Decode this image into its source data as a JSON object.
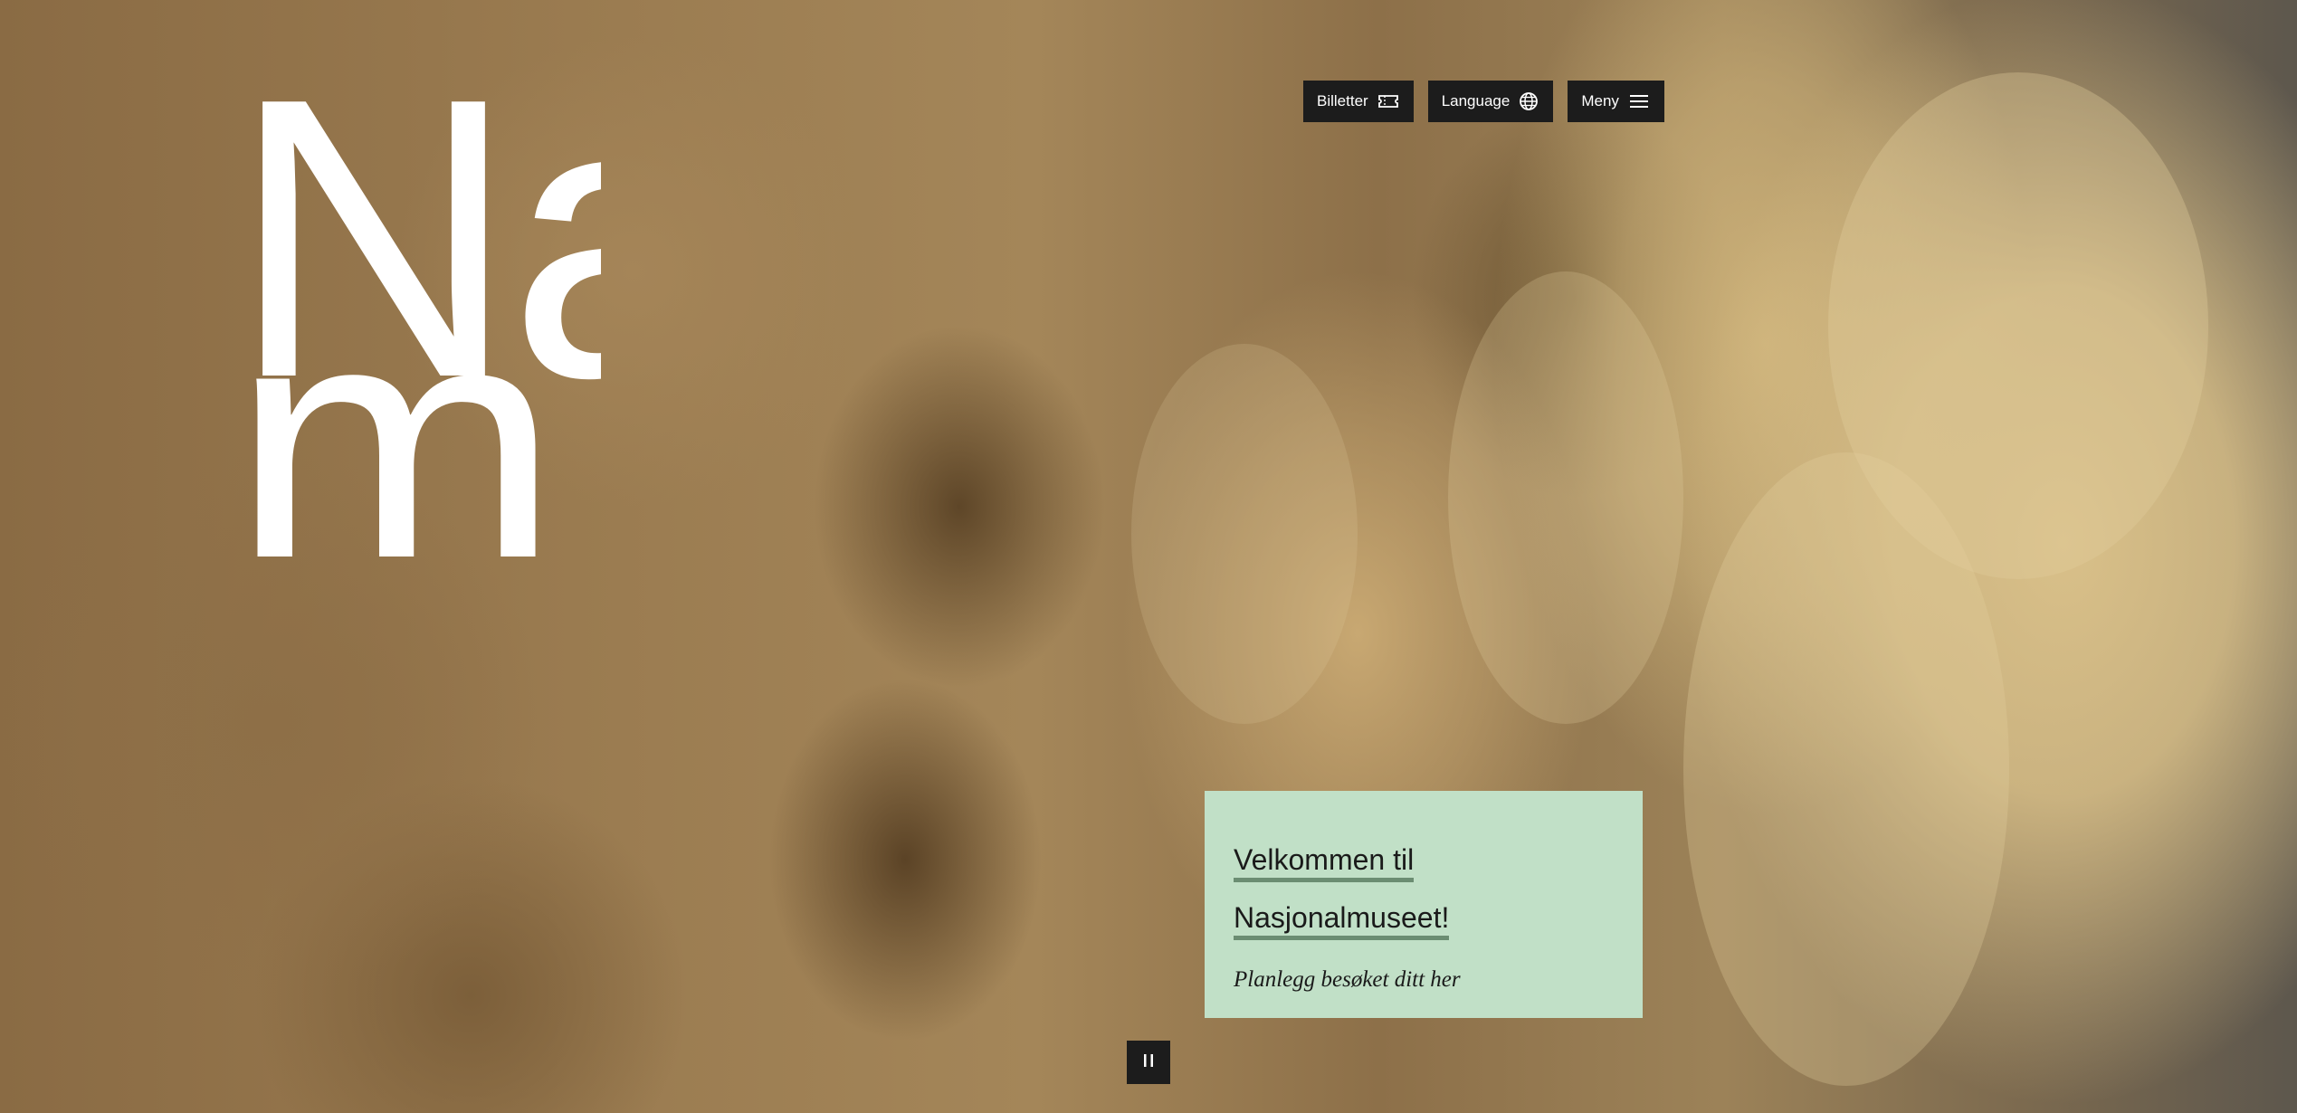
{
  "logo": {
    "line1": "Na",
    "line2": "m"
  },
  "nav": {
    "tickets_label": "Billetter",
    "tickets_icon": "ticket-icon",
    "language_label": "Language",
    "language_icon": "globe-icon",
    "menu_label": "Meny",
    "menu_icon": "hamburger-icon"
  },
  "welcome": {
    "title_line1": "Velkommen til",
    "title_line2": "Nasjonalmuseet!",
    "subtitle": "Planlegg besøket ditt her"
  },
  "media": {
    "pause_icon": "pause-icon"
  },
  "colors": {
    "card_background": "#c1e0c7",
    "card_underline": "#6b8d72",
    "button_background": "#1c1c1c",
    "logo_color": "#ffffff"
  }
}
